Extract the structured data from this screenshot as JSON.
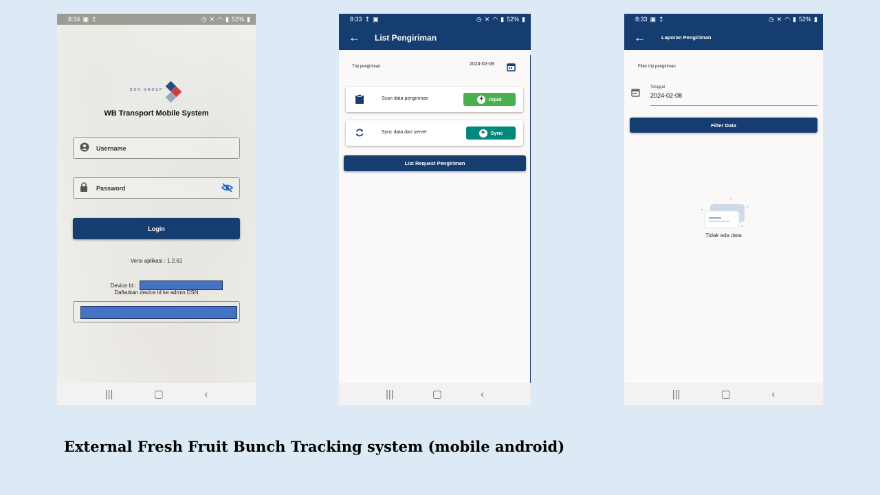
{
  "login_screen": {
    "status_time": "8:34",
    "status_battery": "52%",
    "logo_text": "DSN GROUP",
    "app_title": "WB Transport Mobile System",
    "username_placeholder": "Username",
    "password_placeholder": "Password",
    "login_label": "Login",
    "version_text": "Versi aplikasi : 1.2.61",
    "device_id_label": "Device Id :",
    "register_note": "Daftarkan device id ke admin DSN"
  },
  "list_screen": {
    "status_time": "8:33",
    "status_battery": "52%",
    "title": "List Pengiriman",
    "trip_label": "Trip pengiriman",
    "trip_date": "2024-02-08",
    "scan_label": "Scan data pengiriman",
    "input_label": "Input",
    "sync_label": "Sync data dari server",
    "sync_button_label": "Sync",
    "list_request_label": "List Request Pengiriman"
  },
  "report_screen": {
    "status_time": "8:33",
    "status_battery": "52%",
    "title": "Laporan Pengiriman",
    "filter_label": "Filter trip pengiriman",
    "tanggal_label": "Tanggal",
    "tanggal_value": "2024-02-08",
    "filter_button_label": "Filter Data",
    "empty_text": "Tidak ada data"
  },
  "caption": "External Fresh Fruit Bunch Tracking system (mobile android)",
  "colors": {
    "primary": "#163d70",
    "input_green": "#4caf50",
    "sync_teal": "#00897b",
    "redaction": "#4472c4",
    "background": "#dde9f5"
  }
}
